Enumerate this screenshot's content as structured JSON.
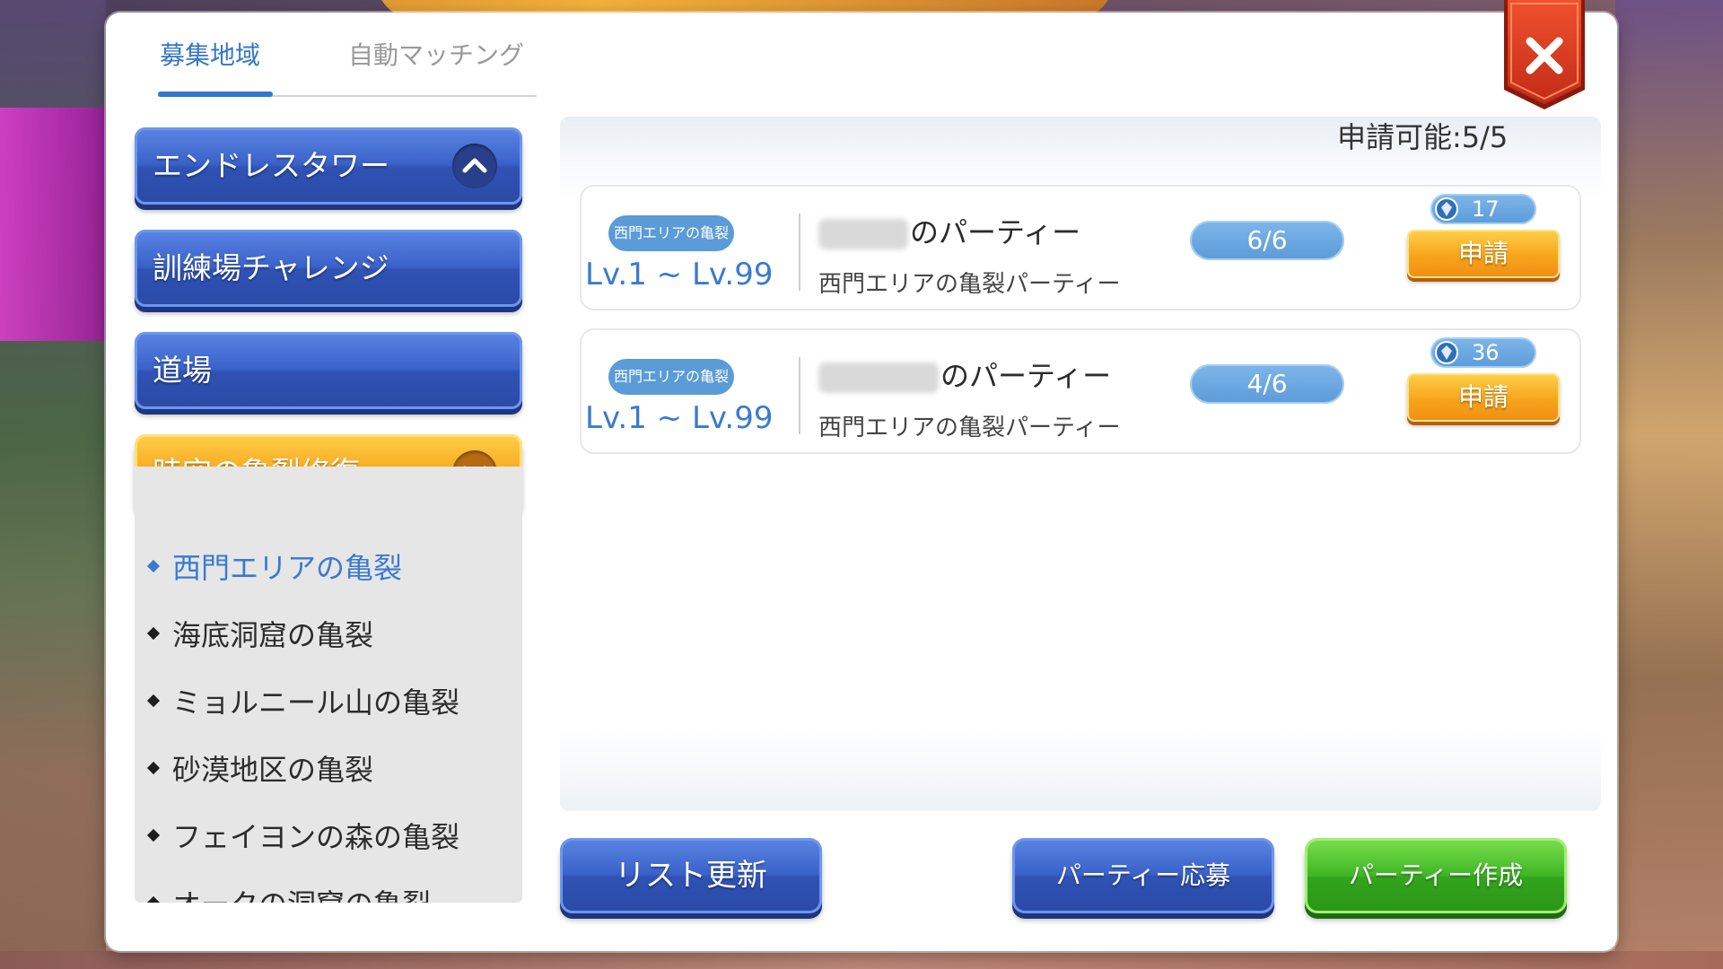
{
  "tabs": [
    {
      "label": "募集地域",
      "active": true
    },
    {
      "label": "自動マッチング",
      "active": false
    }
  ],
  "categories": [
    {
      "label": "エンドレスタワー",
      "expanded": true,
      "color": "#3a61c9"
    },
    {
      "label": "訓練場チャレンジ",
      "color": "#3a61c9"
    },
    {
      "label": "道場",
      "color": "#3a61c9"
    },
    {
      "label": "時空の亀裂修復",
      "expanded": true,
      "color": "#f7a71e"
    }
  ],
  "sub_items": [
    {
      "label": "西門エリアの亀裂",
      "active": true
    },
    {
      "label": "海底洞窟の亀裂"
    },
    {
      "label": "ミョルニール山の亀裂"
    },
    {
      "label": "砂漠地区の亀裂"
    },
    {
      "label": "フェイヨンの森の亀裂"
    },
    {
      "label": "オークの洞窟の亀裂"
    }
  ],
  "apply_count": "申請可能:5/5",
  "parties": [
    {
      "area_tag": "西門エリアの亀裂",
      "level_range": "Lv.1 ~ Lv.99",
      "leader_suffix": "のパーティー",
      "description": "西門エリアの亀裂パーティー",
      "members": "6/6",
      "power": "17",
      "apply_label": "申請"
    },
    {
      "area_tag": "西門エリアの亀裂",
      "level_range": "Lv.1 ~ Lv.99",
      "leader_suffix": "のパーティー",
      "description": "西門エリアの亀裂パーティー",
      "members": "4/6",
      "power": "36",
      "apply_label": "申請"
    }
  ],
  "buttons": {
    "refresh": "リスト更新",
    "join": "パーティー応募",
    "create": "パーティー作成"
  },
  "icons": {
    "close": "close-icon",
    "chevron_up": "chevron-up-icon",
    "chevron_down": "chevron-down-icon",
    "power_gem": "gem-icon"
  }
}
